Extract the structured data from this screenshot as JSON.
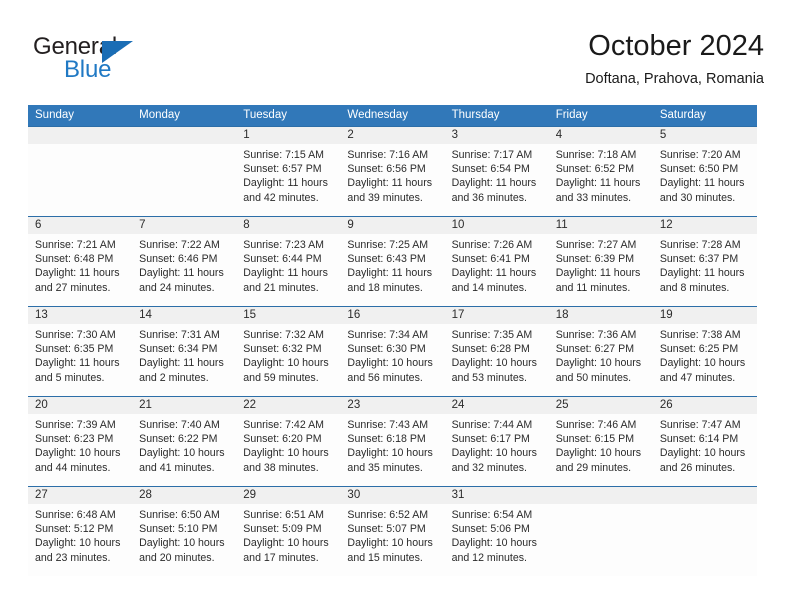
{
  "brand": {
    "name_top": "General",
    "name_bottom": "Blue",
    "triangle_color": "#1a6db5",
    "text_color_top": "#231f20",
    "text_color_bottom": "#2079c4"
  },
  "header": {
    "title": "October 2024",
    "subtitle": "Doftana, Prahova, Romania"
  },
  "colors": {
    "header_blue": "#3178b9",
    "row_divider_blue": "#2c6ea8",
    "date_band_gray": "#f0f0f0",
    "cell_background": "#fdfdfd",
    "text": "#2b2b2b"
  },
  "weekdays": [
    "Sunday",
    "Monday",
    "Tuesday",
    "Wednesday",
    "Thursday",
    "Friday",
    "Saturday"
  ],
  "weeks": [
    [
      {
        "day": "",
        "lines": []
      },
      {
        "day": "",
        "lines": []
      },
      {
        "day": "1",
        "lines": [
          "Sunrise: 7:15 AM",
          "Sunset: 6:57 PM",
          "Daylight: 11 hours",
          "and 42 minutes."
        ]
      },
      {
        "day": "2",
        "lines": [
          "Sunrise: 7:16 AM",
          "Sunset: 6:56 PM",
          "Daylight: 11 hours",
          "and 39 minutes."
        ]
      },
      {
        "day": "3",
        "lines": [
          "Sunrise: 7:17 AM",
          "Sunset: 6:54 PM",
          "Daylight: 11 hours",
          "and 36 minutes."
        ]
      },
      {
        "day": "4",
        "lines": [
          "Sunrise: 7:18 AM",
          "Sunset: 6:52 PM",
          "Daylight: 11 hours",
          "and 33 minutes."
        ]
      },
      {
        "day": "5",
        "lines": [
          "Sunrise: 7:20 AM",
          "Sunset: 6:50 PM",
          "Daylight: 11 hours",
          "and 30 minutes."
        ]
      }
    ],
    [
      {
        "day": "6",
        "lines": [
          "Sunrise: 7:21 AM",
          "Sunset: 6:48 PM",
          "Daylight: 11 hours",
          "and 27 minutes."
        ]
      },
      {
        "day": "7",
        "lines": [
          "Sunrise: 7:22 AM",
          "Sunset: 6:46 PM",
          "Daylight: 11 hours",
          "and 24 minutes."
        ]
      },
      {
        "day": "8",
        "lines": [
          "Sunrise: 7:23 AM",
          "Sunset: 6:44 PM",
          "Daylight: 11 hours",
          "and 21 minutes."
        ]
      },
      {
        "day": "9",
        "lines": [
          "Sunrise: 7:25 AM",
          "Sunset: 6:43 PM",
          "Daylight: 11 hours",
          "and 18 minutes."
        ]
      },
      {
        "day": "10",
        "lines": [
          "Sunrise: 7:26 AM",
          "Sunset: 6:41 PM",
          "Daylight: 11 hours",
          "and 14 minutes."
        ]
      },
      {
        "day": "11",
        "lines": [
          "Sunrise: 7:27 AM",
          "Sunset: 6:39 PM",
          "Daylight: 11 hours",
          "and 11 minutes."
        ]
      },
      {
        "day": "12",
        "lines": [
          "Sunrise: 7:28 AM",
          "Sunset: 6:37 PM",
          "Daylight: 11 hours",
          "and 8 minutes."
        ]
      }
    ],
    [
      {
        "day": "13",
        "lines": [
          "Sunrise: 7:30 AM",
          "Sunset: 6:35 PM",
          "Daylight: 11 hours",
          "and 5 minutes."
        ]
      },
      {
        "day": "14",
        "lines": [
          "Sunrise: 7:31 AM",
          "Sunset: 6:34 PM",
          "Daylight: 11 hours",
          "and 2 minutes."
        ]
      },
      {
        "day": "15",
        "lines": [
          "Sunrise: 7:32 AM",
          "Sunset: 6:32 PM",
          "Daylight: 10 hours",
          "and 59 minutes."
        ]
      },
      {
        "day": "16",
        "lines": [
          "Sunrise: 7:34 AM",
          "Sunset: 6:30 PM",
          "Daylight: 10 hours",
          "and 56 minutes."
        ]
      },
      {
        "day": "17",
        "lines": [
          "Sunrise: 7:35 AM",
          "Sunset: 6:28 PM",
          "Daylight: 10 hours",
          "and 53 minutes."
        ]
      },
      {
        "day": "18",
        "lines": [
          "Sunrise: 7:36 AM",
          "Sunset: 6:27 PM",
          "Daylight: 10 hours",
          "and 50 minutes."
        ]
      },
      {
        "day": "19",
        "lines": [
          "Sunrise: 7:38 AM",
          "Sunset: 6:25 PM",
          "Daylight: 10 hours",
          "and 47 minutes."
        ]
      }
    ],
    [
      {
        "day": "20",
        "lines": [
          "Sunrise: 7:39 AM",
          "Sunset: 6:23 PM",
          "Daylight: 10 hours",
          "and 44 minutes."
        ]
      },
      {
        "day": "21",
        "lines": [
          "Sunrise: 7:40 AM",
          "Sunset: 6:22 PM",
          "Daylight: 10 hours",
          "and 41 minutes."
        ]
      },
      {
        "day": "22",
        "lines": [
          "Sunrise: 7:42 AM",
          "Sunset: 6:20 PM",
          "Daylight: 10 hours",
          "and 38 minutes."
        ]
      },
      {
        "day": "23",
        "lines": [
          "Sunrise: 7:43 AM",
          "Sunset: 6:18 PM",
          "Daylight: 10 hours",
          "and 35 minutes."
        ]
      },
      {
        "day": "24",
        "lines": [
          "Sunrise: 7:44 AM",
          "Sunset: 6:17 PM",
          "Daylight: 10 hours",
          "and 32 minutes."
        ]
      },
      {
        "day": "25",
        "lines": [
          "Sunrise: 7:46 AM",
          "Sunset: 6:15 PM",
          "Daylight: 10 hours",
          "and 29 minutes."
        ]
      },
      {
        "day": "26",
        "lines": [
          "Sunrise: 7:47 AM",
          "Sunset: 6:14 PM",
          "Daylight: 10 hours",
          "and 26 minutes."
        ]
      }
    ],
    [
      {
        "day": "27",
        "lines": [
          "Sunrise: 6:48 AM",
          "Sunset: 5:12 PM",
          "Daylight: 10 hours",
          "and 23 minutes."
        ]
      },
      {
        "day": "28",
        "lines": [
          "Sunrise: 6:50 AM",
          "Sunset: 5:10 PM",
          "Daylight: 10 hours",
          "and 20 minutes."
        ]
      },
      {
        "day": "29",
        "lines": [
          "Sunrise: 6:51 AM",
          "Sunset: 5:09 PM",
          "Daylight: 10 hours",
          "and 17 minutes."
        ]
      },
      {
        "day": "30",
        "lines": [
          "Sunrise: 6:52 AM",
          "Sunset: 5:07 PM",
          "Daylight: 10 hours",
          "and 15 minutes."
        ]
      },
      {
        "day": "31",
        "lines": [
          "Sunrise: 6:54 AM",
          "Sunset: 5:06 PM",
          "Daylight: 10 hours",
          "and 12 minutes."
        ]
      },
      {
        "day": "",
        "lines": []
      },
      {
        "day": "",
        "lines": []
      }
    ]
  ]
}
